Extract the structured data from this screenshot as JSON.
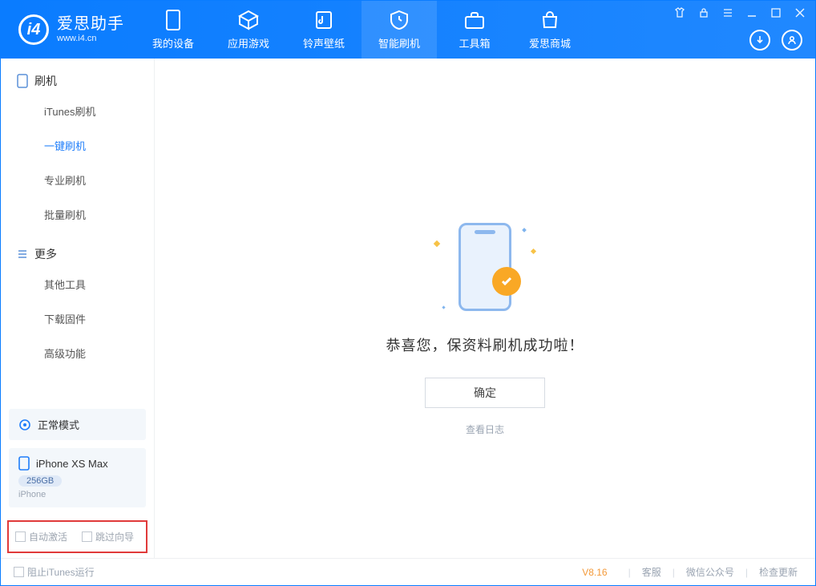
{
  "brand": {
    "name": "爱思助手",
    "site": "www.i4.cn"
  },
  "tabs": [
    {
      "label": "我的设备"
    },
    {
      "label": "应用游戏"
    },
    {
      "label": "铃声壁纸"
    },
    {
      "label": "智能刷机"
    },
    {
      "label": "工具箱"
    },
    {
      "label": "爱思商城"
    }
  ],
  "sidebar": {
    "section1": {
      "title": "刷机",
      "items": [
        "iTunes刷机",
        "一键刷机",
        "专业刷机",
        "批量刷机"
      ]
    },
    "section2": {
      "title": "更多",
      "items": [
        "其他工具",
        "下载固件",
        "高级功能"
      ]
    }
  },
  "device": {
    "mode": "正常模式",
    "name": "iPhone XS Max",
    "storage": "256GB",
    "type": "iPhone"
  },
  "options": {
    "auto_activate": "自动激活",
    "skip_guide": "跳过向导"
  },
  "main": {
    "success": "恭喜您，保资料刷机成功啦！",
    "ok": "确定",
    "log": "查看日志"
  },
  "footer": {
    "block_itunes": "阻止iTunes运行",
    "version": "V8.16",
    "support": "客服",
    "wechat": "微信公众号",
    "update": "检查更新"
  }
}
